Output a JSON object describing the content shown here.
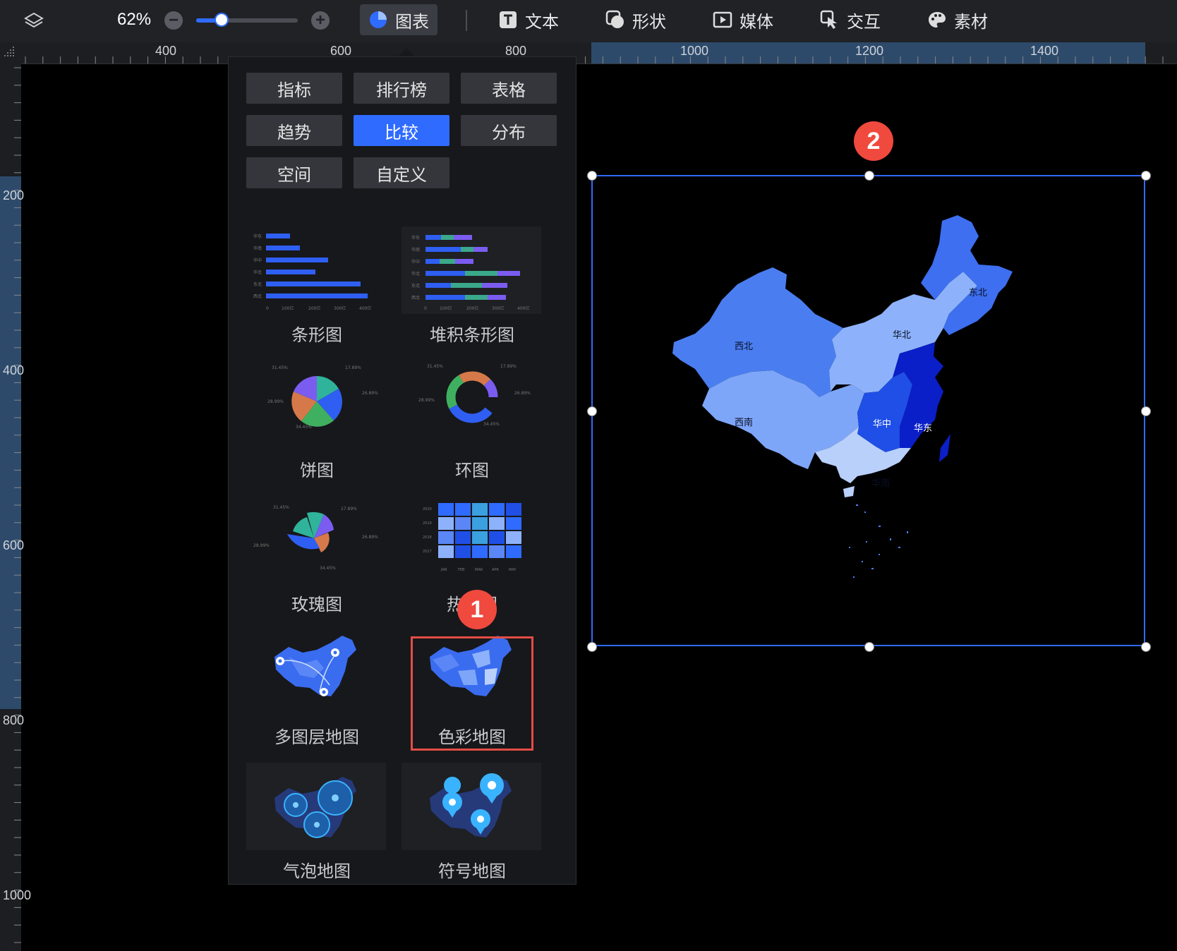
{
  "toolbar": {
    "zoom_label": "62%",
    "zoom_value": 0.25,
    "tabs": [
      {
        "label": "图表",
        "icon": "chart-pie-icon",
        "active": true
      },
      {
        "label": "文本",
        "icon": "text-icon"
      },
      {
        "label": "形状",
        "icon": "shape-icon"
      },
      {
        "label": "媒体",
        "icon": "media-icon"
      },
      {
        "label": "交互",
        "icon": "interaction-icon"
      },
      {
        "label": "素材",
        "icon": "palette-icon"
      }
    ]
  },
  "ruler": {
    "top": [
      "400",
      "600",
      "800",
      "1000",
      "1200",
      "1400"
    ],
    "left": [
      "200",
      "400",
      "600",
      "800",
      "1000"
    ]
  },
  "panel": {
    "categories": [
      "指标",
      "排行榜",
      "表格",
      "趋势",
      "比较",
      "分布",
      "空间",
      "自定义"
    ],
    "active_category": "比较",
    "charts": [
      "条形图",
      "堆积条形图",
      "饼图",
      "环图",
      "玫瑰图",
      "热力图",
      "多图层地图",
      "色彩地图",
      "气泡地图",
      "符号地图"
    ],
    "selected_chart": "色彩地图",
    "pie_labels": [
      "31.45%",
      "17.89%",
      "26.89%",
      "28.99%",
      "34.45%"
    ],
    "bar_categories": [
      "华东",
      "华南",
      "华中",
      "华北",
      "东北",
      "西北"
    ],
    "bar_axis": [
      "0",
      "100亿",
      "200亿",
      "300亿",
      "400亿"
    ],
    "heat_years": [
      "2020",
      "2019",
      "2018",
      "2017"
    ],
    "heat_months": [
      "JAN",
      "FEB",
      "MAR",
      "APR",
      "MAY"
    ]
  },
  "steps": [
    "1",
    "2"
  ],
  "map": {
    "regions": [
      {
        "name": "西北",
        "color": "#4a7ef0"
      },
      {
        "name": "华北",
        "color": "#8db2fb"
      },
      {
        "name": "东北",
        "color": "#3d6ff0"
      },
      {
        "name": "西南",
        "color": "#7ea6f8"
      },
      {
        "name": "华中",
        "color": "#1f4fe6"
      },
      {
        "name": "华东",
        "color": "#0a1fc8"
      },
      {
        "name": "华南",
        "color": "#b9d0fb"
      }
    ]
  },
  "colors": {
    "accent": "#2f6bff",
    "highlight": "#e34d45"
  }
}
